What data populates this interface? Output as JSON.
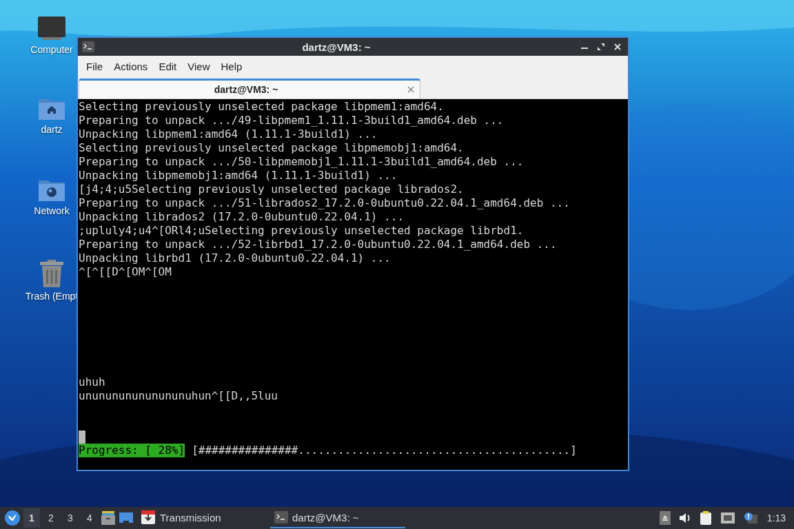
{
  "desktop_icons": [
    {
      "label": "Computer",
      "kind": "computer"
    },
    {
      "label": "dartz",
      "kind": "home"
    },
    {
      "label": "Network",
      "kind": "network"
    },
    {
      "label": "Trash (Empt",
      "kind": "trash"
    }
  ],
  "window": {
    "title": "dartz@VM3: ~",
    "menu": [
      "File",
      "Actions",
      "Edit",
      "View",
      "Help"
    ],
    "tabs": [
      {
        "label": "dartz@VM3: ~",
        "selected": true
      }
    ],
    "terminal": {
      "lines": [
        "Selecting previously unselected package libpmem1:amd64.",
        "Preparing to unpack .../49-libpmem1_1.11.1-3build1_amd64.deb ...",
        "Unpacking libpmem1:amd64 (1.11.1-3build1) ...",
        "Selecting previously unselected package libpmemobj1:amd64.",
        "Preparing to unpack .../50-libpmemobj1_1.11.1-3build1_amd64.deb ...",
        "Unpacking libpmemobj1:amd64 (1.11.1-3build1) ...",
        "[j4;4;u5Selecting previously unselected package librados2.",
        "Preparing to unpack .../51-librados2_17.2.0-0ubuntu0.22.04.1_amd64.deb ...",
        "Unpacking librados2 (17.2.0-0ubuntu0.22.04.1) ...",
        ";upluly4;u4^[ORl4;uSelecting previously unselected package librbd1.",
        "Preparing to unpack .../52-librbd1_17.2.0-0ubuntu0.22.04.1_amd64.deb ...",
        "Unpacking librbd1 (17.2.0-0ubuntu0.22.04.1) ...",
        "^[^[[D^[OM^[OM"
      ],
      "tail_lines": [
        "uhuh",
        "ununununununununuhun^[[D,,5luu"
      ],
      "progress_label": "Progress: [ 28%]",
      "progress_bar": "[###############.........................................]"
    }
  },
  "taskbar": {
    "workspaces": [
      {
        "label": "1",
        "selected": true
      },
      {
        "label": "2",
        "selected": false
      },
      {
        "label": "3",
        "selected": false
      },
      {
        "label": "4",
        "selected": false
      }
    ],
    "tasks": [
      {
        "label": "Transmission",
        "kind": "transmission",
        "selected": false
      },
      {
        "label": "dartz@VM3: ~",
        "kind": "terminal",
        "selected": true
      }
    ],
    "clock": "1:13"
  }
}
